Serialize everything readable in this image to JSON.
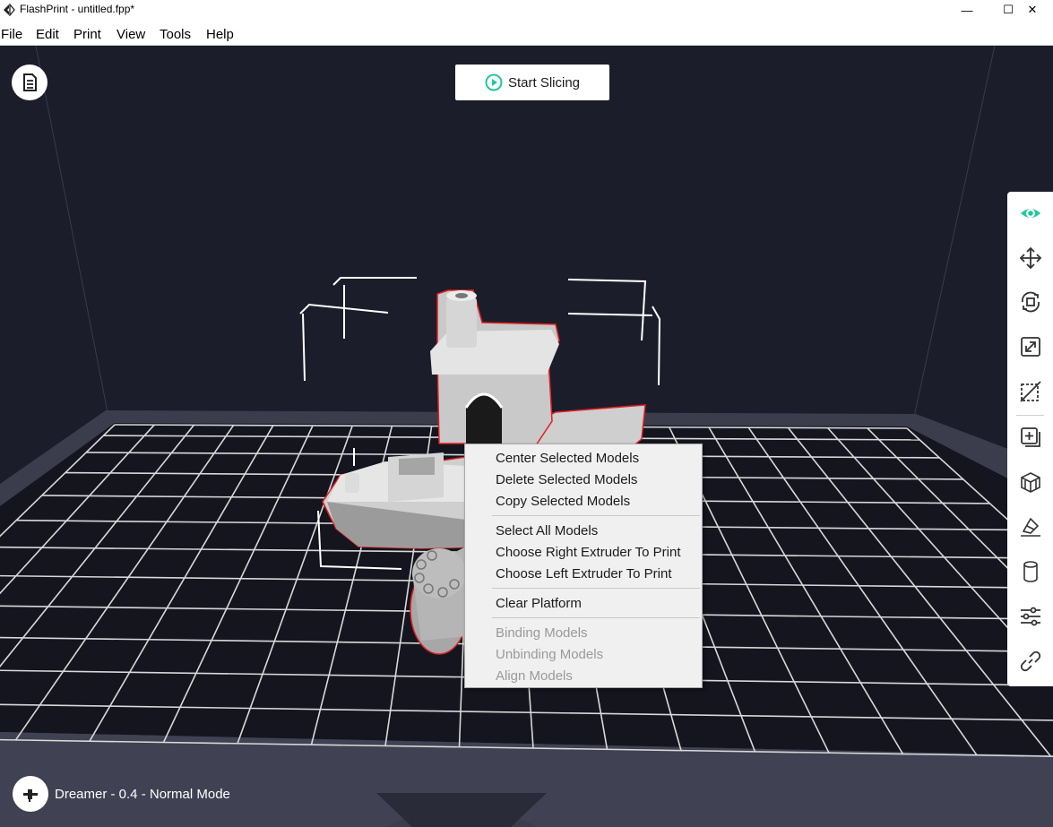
{
  "window": {
    "title": "FlashPrint - untitled.fpp*",
    "minimize_glyph": "—",
    "maximize_glyph": "☐",
    "close_glyph": "✕"
  },
  "menu": [
    "File",
    "Edit",
    "Print",
    "View",
    "Tools",
    "Help"
  ],
  "viewport": {
    "slice_button_label": "Start Slicing",
    "status_text": "Dreamer - 0.4 - Normal Mode",
    "doc_icon": "document-icon",
    "printer_icon": "printer-icon"
  },
  "toolbar": {
    "items": [
      {
        "icon": "view-eye-icon",
        "active": true
      },
      {
        "icon": "move-icon"
      },
      {
        "icon": "rotate-icon"
      },
      {
        "icon": "scale-icon"
      },
      {
        "icon": "cut-icon"
      },
      {
        "icon": "add-model-icon"
      },
      {
        "icon": "supports-icon"
      },
      {
        "icon": "place-on-face-icon"
      },
      {
        "icon": "cylinder-icon"
      },
      {
        "icon": "settings-sliders-icon"
      },
      {
        "icon": "link-icon"
      }
    ]
  },
  "context_menu": {
    "groups": [
      [
        {
          "label": "Center Selected Models",
          "enabled": true
        },
        {
          "label": "Delete Selected Models",
          "enabled": true
        },
        {
          "label": "Copy Selected Models",
          "enabled": true
        }
      ],
      [
        {
          "label": "Select All Models",
          "enabled": true
        },
        {
          "label": "Choose Right Extruder To Print",
          "enabled": true
        },
        {
          "label": "Choose Left Extruder To Print",
          "enabled": true
        }
      ],
      [
        {
          "label": "Clear Platform",
          "enabled": true
        }
      ],
      [
        {
          "label": "Binding Models",
          "enabled": false
        },
        {
          "label": "Unbinding Models",
          "enabled": false
        },
        {
          "label": "Align Models",
          "enabled": false
        }
      ]
    ]
  },
  "colors": {
    "accent": "#1fc99a",
    "background": "#1c1d2a",
    "grid": "#e0e0e0",
    "selection_outline": "#e02020"
  }
}
